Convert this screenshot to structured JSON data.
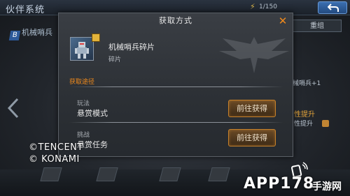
{
  "background": {
    "system_title": "伙伴系统",
    "top_counter": "1/150",
    "companion_tab": "机械哨兵",
    "regroup_button": "重组",
    "side_label_1": "械哨兵+1",
    "side_label_2": "性提升",
    "side_label_3": "性提升"
  },
  "modal": {
    "title": "获取方式",
    "item": {
      "name": "机械哨兵碎片",
      "type": "碎片"
    },
    "source_heading": "获取途径",
    "ways": [
      {
        "category": "玩法",
        "name": "悬赏模式",
        "button_label": "前往获得"
      },
      {
        "category": "挑战",
        "name": "悬赏任务",
        "button_label": "前往获得"
      }
    ]
  },
  "overlay": {
    "copyright_line_1": "©TENCENT",
    "copyright_line_2": "© KONAMI",
    "watermark_text": "APP178",
    "watermark_cn": "手游网"
  },
  "colors": {
    "accent_orange": "#f08a1c",
    "button_border": "#c7812a"
  }
}
